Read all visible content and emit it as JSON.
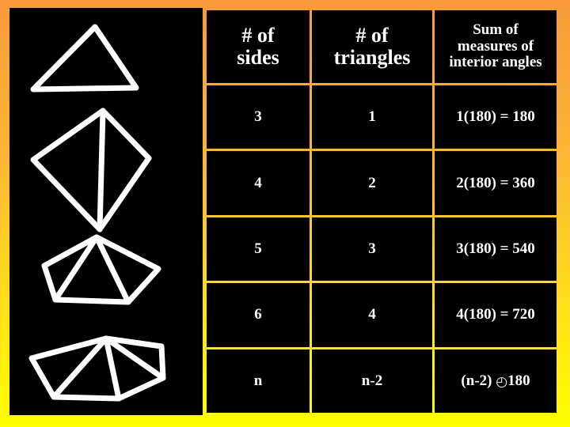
{
  "slide": {
    "background_top_color": "#f89a3c",
    "background_bottom_color": "#ffff00",
    "panel_background_color": "#000000",
    "text_color": "#ffffff"
  },
  "shapes_panel": {
    "name": "polygon-diagrams",
    "figures": [
      {
        "name": "triangle",
        "sides": 3,
        "triangles": 1,
        "diagonals": 0
      },
      {
        "name": "quadrilateral",
        "sides": 4,
        "triangles": 2,
        "diagonals": 1
      },
      {
        "name": "pentagon",
        "sides": 5,
        "triangles": 3,
        "diagonals": 2
      },
      {
        "name": "hexagon",
        "sides": 6,
        "triangles": 4,
        "diagonals": 3
      }
    ]
  },
  "table": {
    "headers": [
      "# of\nsides",
      "# of\ntriangles",
      "Sum of measures of interior angles"
    ],
    "headers_lines": {
      "sides_line1": "# of",
      "sides_line2": "sides",
      "triangles_line1": "# of",
      "triangles_line2": "triangles",
      "sum_line1": "Sum of",
      "sum_line2": "measures of",
      "sum_line3": "interior angles"
    },
    "rows": [
      {
        "sides": "3",
        "triangles": "1",
        "sum": "1(180) = 180"
      },
      {
        "sides": "4",
        "triangles": "2",
        "sum": "2(180) = 360"
      },
      {
        "sides": "5",
        "triangles": "3",
        "sum": "3(180) = 540"
      },
      {
        "sides": "6",
        "triangles": "4",
        "sum": "4(180) = 720"
      },
      {
        "sides": "n",
        "triangles": "n-2",
        "sum_prefix": "(n-2) ",
        "sum_symbol": "◴",
        "sum_suffix": "180"
      }
    ]
  },
  "chart_data": {
    "type": "table",
    "title": "Sum of interior angle measures of polygons",
    "columns": [
      "# of sides",
      "# of triangles",
      "Sum of measures of interior angles"
    ],
    "rows": [
      [
        "3",
        "1",
        "1(180) = 180"
      ],
      [
        "4",
        "2",
        "2(180) = 360"
      ],
      [
        "5",
        "3",
        "3(180) = 540"
      ],
      [
        "6",
        "4",
        "4(180) = 720"
      ],
      [
        "n",
        "n-2",
        "(n-2) × 180"
      ]
    ],
    "sides": [
      3,
      4,
      5,
      6
    ],
    "triangles": [
      1,
      2,
      3,
      4
    ],
    "angle_sums": [
      180,
      360,
      540,
      720
    ],
    "formula": "(n-2) * 180"
  }
}
